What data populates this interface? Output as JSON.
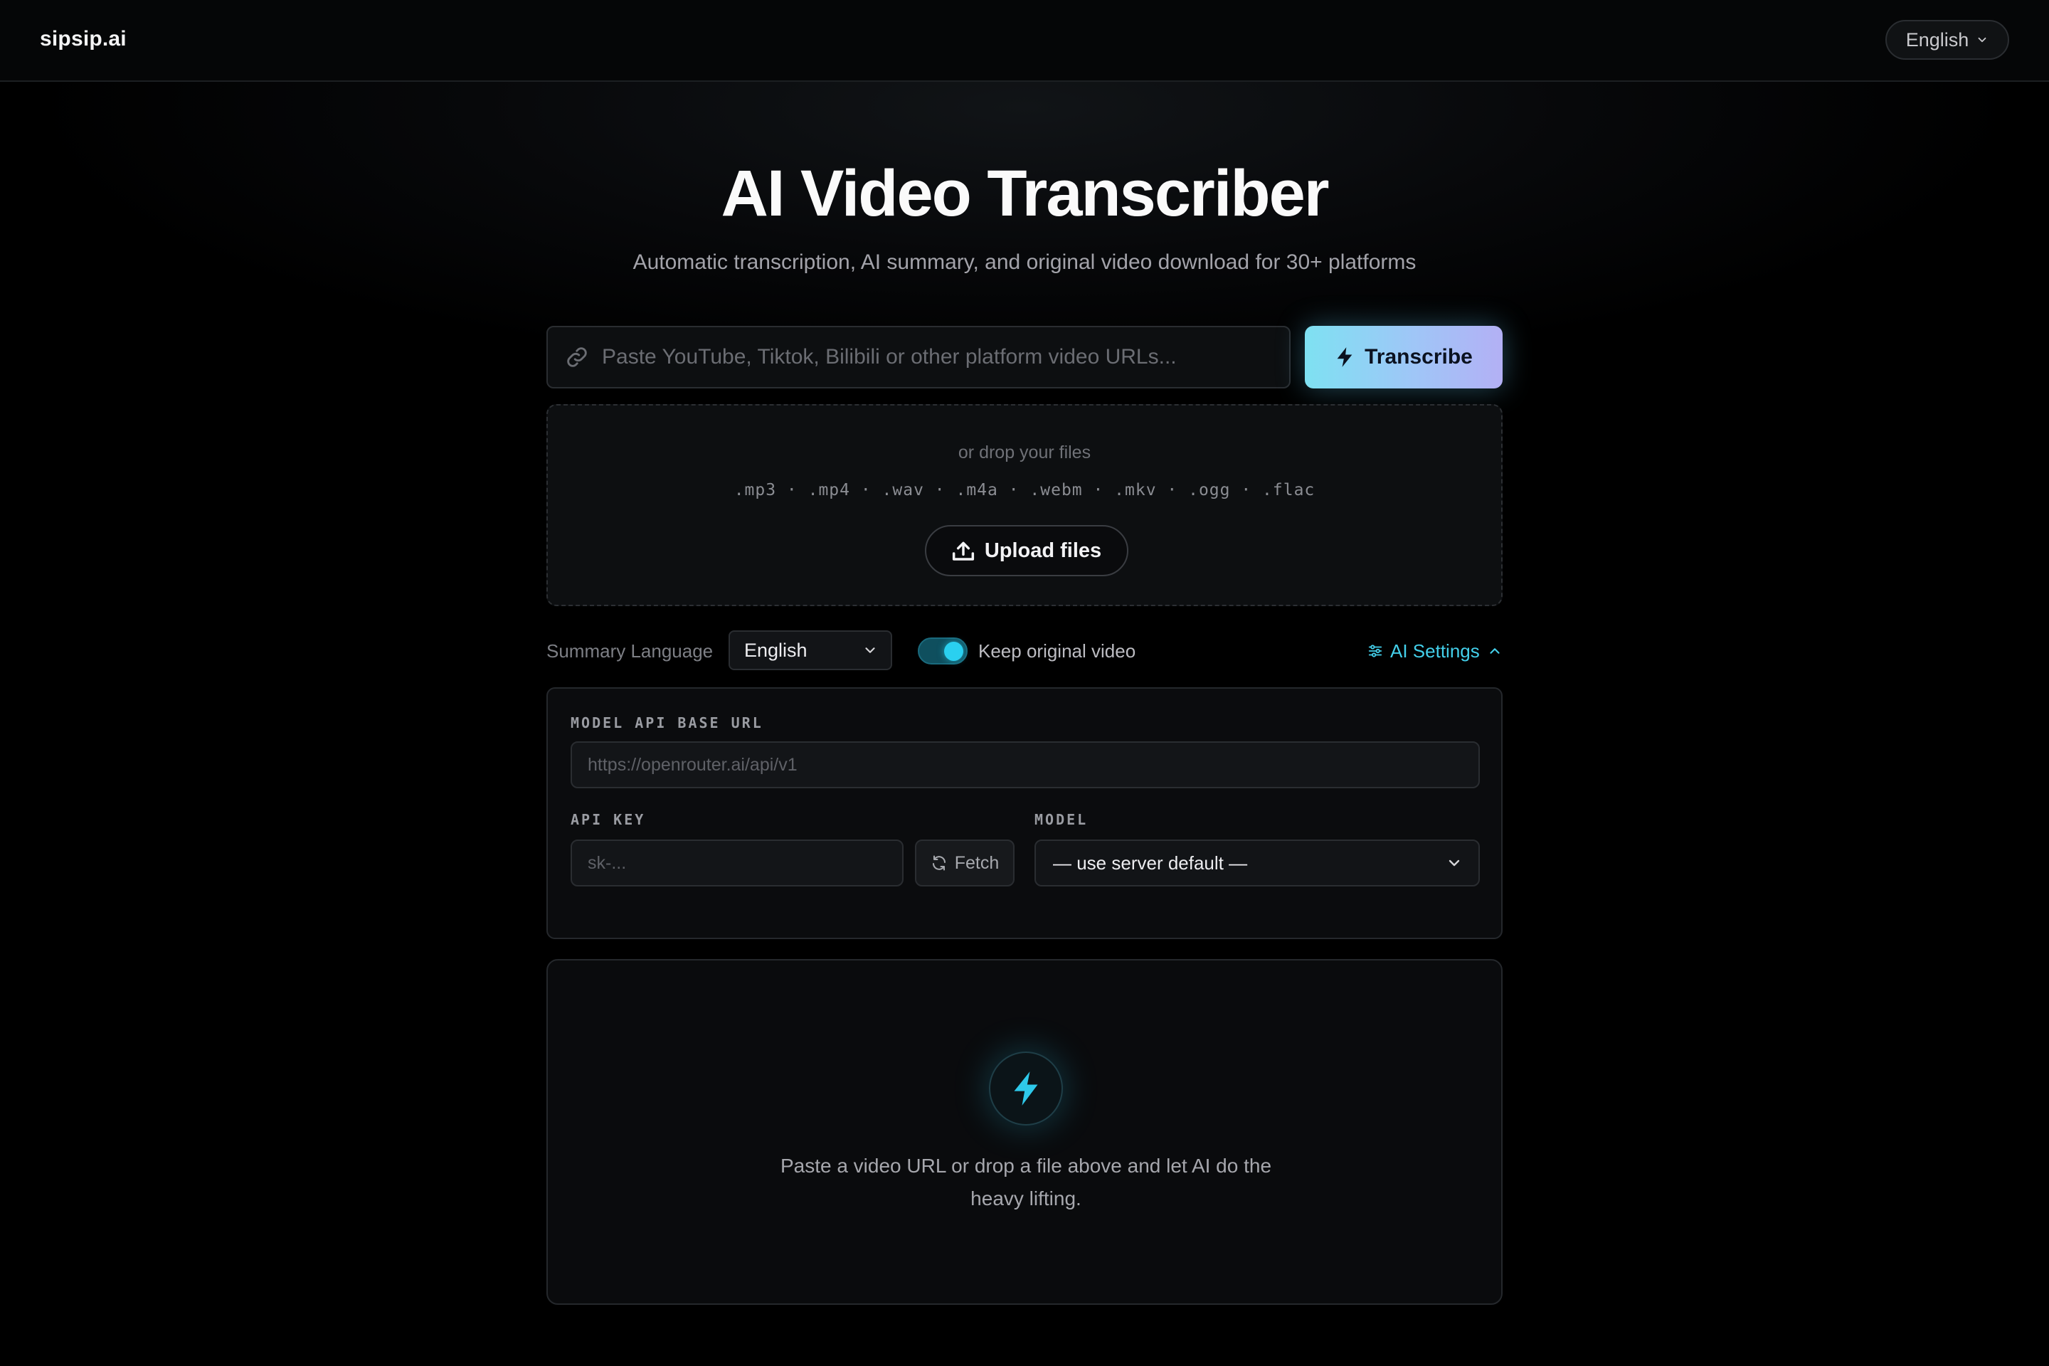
{
  "header": {
    "logo": "sipsip.ai",
    "language_selector": "English"
  },
  "hero": {
    "title": "AI Video Transcriber",
    "subtitle": "Automatic transcription, AI summary, and original video download for 30+ platforms"
  },
  "url_input": {
    "placeholder": "Paste YouTube, Tiktok, Bilibili or other platform video URLs...",
    "value": ""
  },
  "transcribe_button": "Transcribe",
  "drop_zone": {
    "text": "or drop your files",
    "formats": ".mp3 · .mp4 · .wav · .m4a · .webm · .mkv · .ogg · .flac",
    "upload_button": "Upload files"
  },
  "options": {
    "summary_language_label": "Summary Language",
    "summary_language_value": "English",
    "keep_original_label": "Keep original video",
    "keep_original_enabled": true,
    "ai_settings_label": "AI Settings"
  },
  "ai_settings": {
    "base_url_label": "MODEL API BASE URL",
    "base_url_placeholder": "https://openrouter.ai/api/v1",
    "api_key_label": "API KEY",
    "api_key_placeholder": "sk-...",
    "fetch_button": "Fetch",
    "model_label": "MODEL",
    "model_value": "— use server default —"
  },
  "empty_state": {
    "message": "Paste a video URL or drop a file above and let AI do the heavy lifting."
  },
  "colors": {
    "accent": "#43cfea",
    "toggle_on": "#2ad0f0",
    "button_gradient_start": "#7ee1f2",
    "button_gradient_end": "#b3b0f5"
  },
  "icons": [
    "link-icon",
    "bolt-icon",
    "upload-icon",
    "chevron-down-icon",
    "sliders-icon",
    "chevron-up-icon",
    "refresh-icon"
  ]
}
